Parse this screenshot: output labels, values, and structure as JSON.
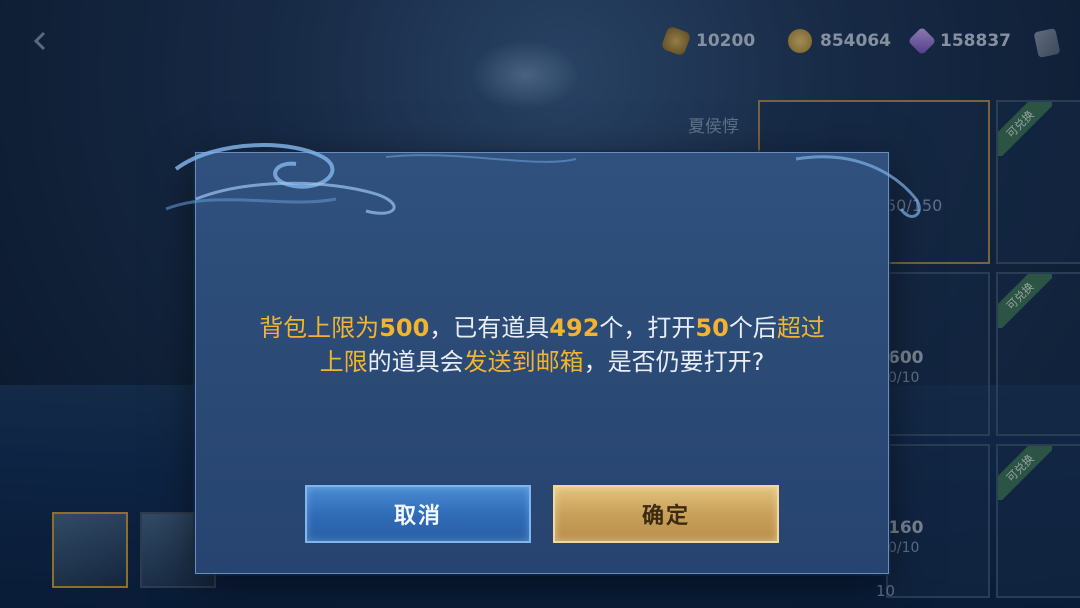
{
  "topbar": {
    "resources": [
      {
        "icon": "token-icon",
        "value": "10200"
      },
      {
        "icon": "gold-coin-icon",
        "value": "854064"
      },
      {
        "icon": "gem-icon",
        "value": "158837"
      }
    ]
  },
  "background": {
    "shop_header_small": "夏侯惇",
    "card_counts": [
      "50/150",
      "600",
      "160"
    ],
    "card_counts_sub": [
      "0/10",
      "0/10"
    ],
    "card_bottom_count": "10",
    "card_ribbon": "可兑换"
  },
  "dialog": {
    "message_line1": [
      {
        "t": "背包上限为",
        "s": "hl"
      },
      {
        "t": "500",
        "s": "hlb"
      },
      {
        "t": "，已有道具",
        "s": ""
      },
      {
        "t": "492",
        "s": "hlb"
      },
      {
        "t": "个，打开",
        "s": ""
      },
      {
        "t": "50",
        "s": "hlb"
      },
      {
        "t": "个后",
        "s": ""
      },
      {
        "t": "超过",
        "s": "hl"
      }
    ],
    "message_line2": [
      {
        "t": "上限",
        "s": "hl"
      },
      {
        "t": "的道具会",
        "s": ""
      },
      {
        "t": "发送到邮箱",
        "s": "hl"
      },
      {
        "t": "，是否仍要打开?",
        "s": ""
      }
    ],
    "cancel_label": "取消",
    "confirm_label": "确定"
  },
  "colors": {
    "highlight": "#f2b430",
    "dialog_bg": "#2b4a75",
    "cancel_button": "#2f6ab5",
    "confirm_button": "#c9a05a"
  }
}
